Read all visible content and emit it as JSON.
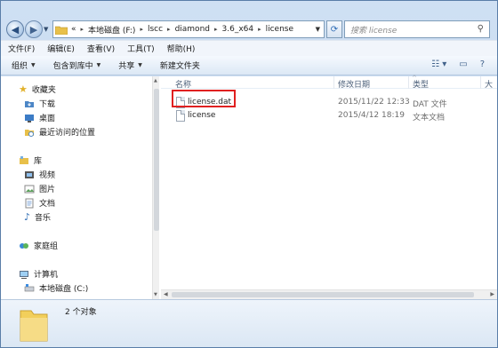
{
  "address": {
    "crumbs": [
      "«",
      "本地磁盘 (F:)",
      "lscc",
      "diamond",
      "3.6_x64",
      "license"
    ]
  },
  "search": {
    "placeholder": "搜索 license"
  },
  "menu": [
    "文件(F)",
    "编辑(E)",
    "查看(V)",
    "工具(T)",
    "帮助(H)"
  ],
  "toolbar": {
    "organize": "组织",
    "include_library": "包含到库中",
    "share": "共享",
    "new_folder": "新建文件夹"
  },
  "nav": {
    "favorites": "收藏夹",
    "downloads": "下载",
    "desktop": "桌面",
    "recent": "最近访问的位置",
    "libraries": "库",
    "videos": "视频",
    "pictures": "图片",
    "documents": "文档",
    "music": "音乐",
    "homegroup": "家庭组",
    "computer": "计算机",
    "local_disk_c": "本地磁盘 (C:)"
  },
  "columns": {
    "name": "名称",
    "modified": "修改日期",
    "type": "类型",
    "size": "大"
  },
  "files": [
    {
      "name": "license.dat",
      "modified": "2015/11/22 12:33",
      "type": "DAT 文件"
    },
    {
      "name": "license",
      "modified": "2015/4/12 18:19",
      "type": "文本文档"
    }
  ],
  "status": {
    "count": "2 个对象"
  },
  "colors": {
    "highlight": "#e02020",
    "folder": "#f2cf5b"
  }
}
